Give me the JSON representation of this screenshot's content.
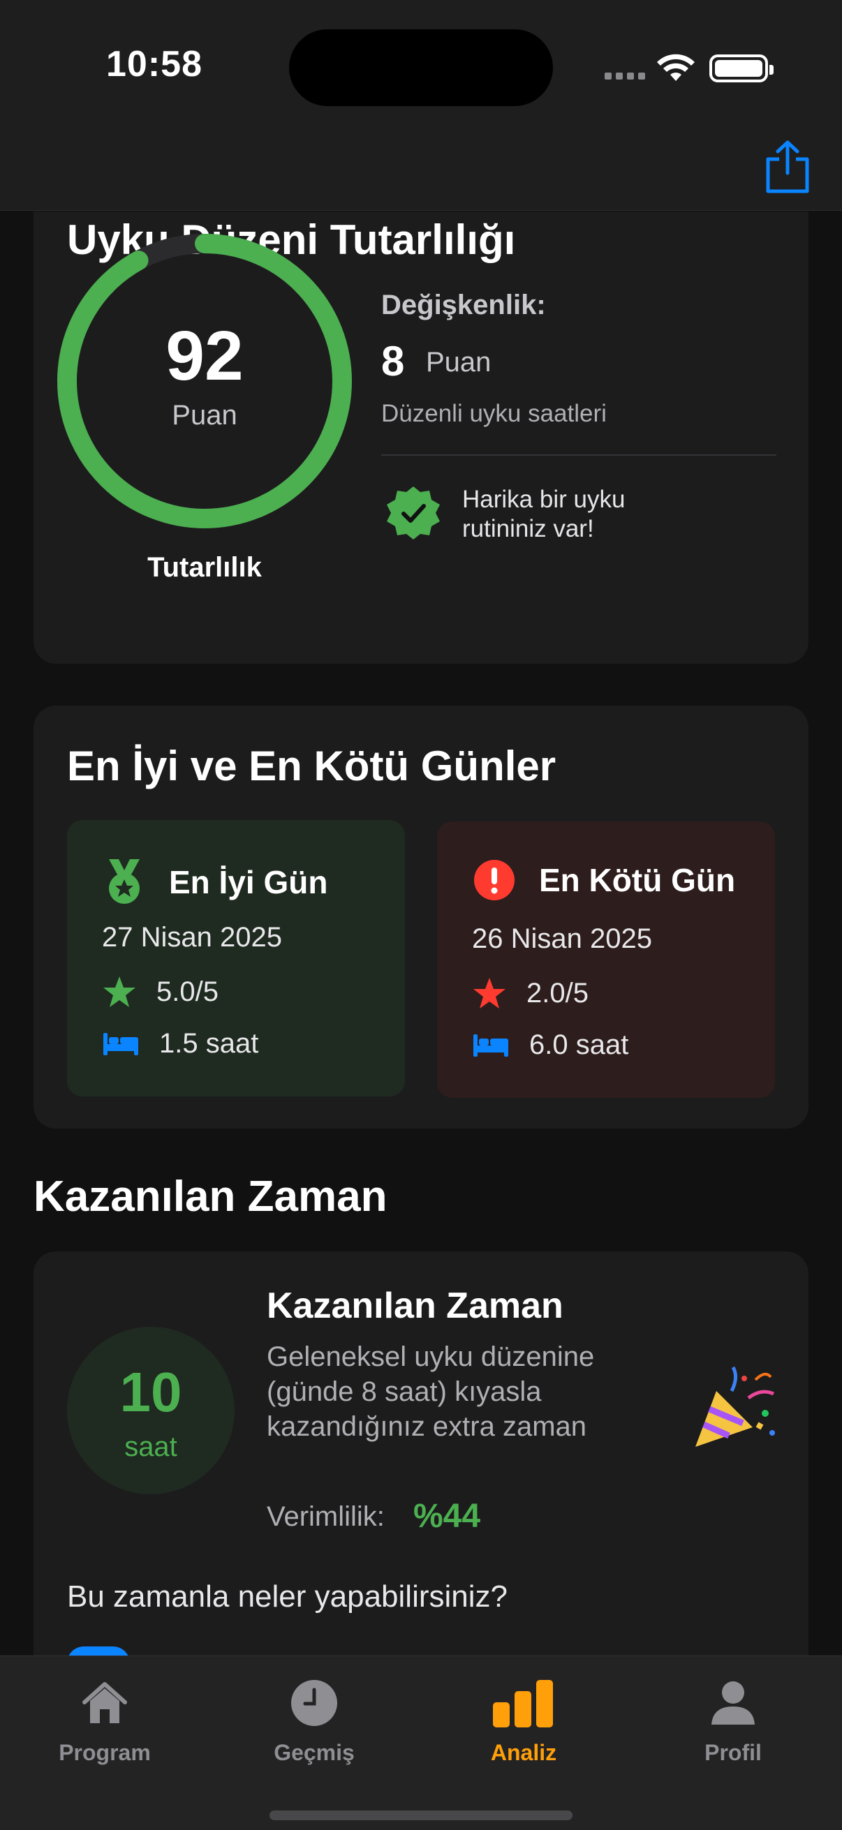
{
  "status_bar": {
    "time": "10:58"
  },
  "header": {
    "share_icon": "share-icon"
  },
  "consistency": {
    "title": "Uyku Düzeni Tutarlılığı",
    "score": "92",
    "score_unit": "Puan",
    "score_fraction": 0.92,
    "ring_label": "Tutarlılık",
    "variability_label": "Değişkenlik:",
    "variability_value": "8",
    "variability_unit": "Puan",
    "variability_desc": "Düzenli uyku saatleri",
    "badge_text": "Harika bir uyku rutininiz var!",
    "accent_color": "#4caf50"
  },
  "best_worst": {
    "title": "En İyi ve En Kötü Günler",
    "best": {
      "title": "En İyi Gün",
      "date": "27 Nisan 2025",
      "rating": "5.0/5",
      "duration": "1.5 saat",
      "icon": "medal-icon"
    },
    "worst": {
      "title": "En Kötü Gün",
      "date": "26 Nisan 2025",
      "rating": "2.0/5",
      "duration": "6.0 saat",
      "icon": "exclamation-icon"
    }
  },
  "gained": {
    "section_title": "Kazanılan Zaman",
    "card_title": "Kazanılan Zaman",
    "hours": "10",
    "hours_unit": "saat",
    "description": "Geleneksel uyku düzenine (günde 8 saat) kıyasla kazandığınız extra zaman",
    "efficiency_label": "Verimlilik:",
    "efficiency_value": "%44",
    "question": "Bu zamanla neler yapabilirsiniz?",
    "icon": "party-popper-icon"
  },
  "tabs": [
    {
      "label": "Program",
      "icon": "house-icon",
      "active": false
    },
    {
      "label": "Geçmiş",
      "icon": "clock-icon",
      "active": false
    },
    {
      "label": "Analiz",
      "icon": "bar-chart-icon",
      "active": true
    },
    {
      "label": "Profil",
      "icon": "person-icon",
      "active": false
    }
  ],
  "colors": {
    "green": "#4caf50",
    "red": "#ff3b30",
    "blue": "#0a84ff",
    "orange": "#ff9f0a",
    "background": "#111111",
    "card": "#1c1c1d"
  }
}
